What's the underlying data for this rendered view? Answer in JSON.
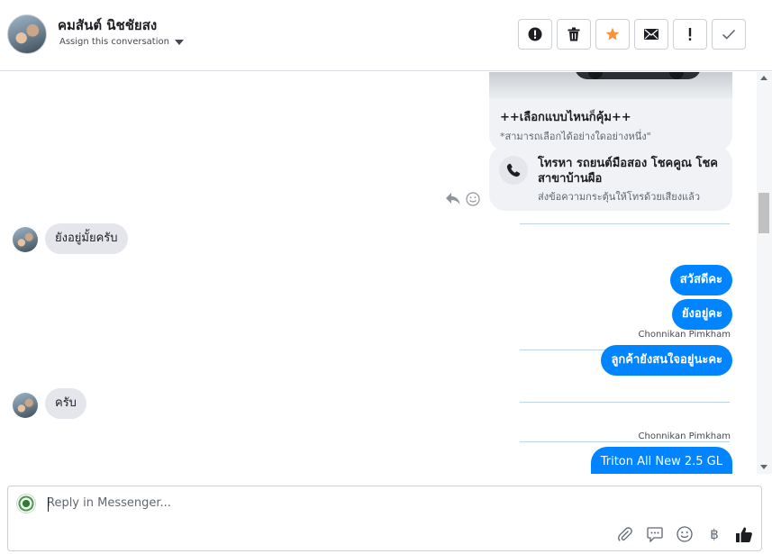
{
  "header": {
    "contact_name": "คมสันต์ นิชชัยสง",
    "assign_label": "Assign this conversation",
    "actions": [
      {
        "name": "spam-button",
        "icon": "exclamation-circle-icon"
      },
      {
        "name": "delete-button",
        "icon": "trash-icon"
      },
      {
        "name": "star-button",
        "icon": "star-icon",
        "color": "#f7923b"
      },
      {
        "name": "mark-unread-button",
        "icon": "envelope-icon"
      },
      {
        "name": "follow-up-button",
        "icon": "exclamation-icon"
      },
      {
        "name": "mark-done-button",
        "icon": "check-icon"
      }
    ]
  },
  "thread": {
    "product_card": {
      "title": "++เลือกแบบไหนก็คุ้ม++",
      "subtitle": "*สามารถเลือกได้อย่างใดอย่างหนึ่ง\""
    },
    "call_card": {
      "title": "โทรหา รถยนต์มือสอง โชคคูณ โชค สาขาบ้านผือ",
      "subtitle": "ส่งข้อความกระตุ้นให้โทรด้วยเสียงแล้ว"
    },
    "messages": [
      {
        "direction": "in",
        "text": "ยังอยู่มั้ยครับ"
      },
      {
        "direction": "out",
        "text": "สวัสดีคะ"
      },
      {
        "direction": "out",
        "text": "ยังอยู่คะ"
      },
      {
        "direction": "out",
        "sender": "Chonnikan Pimkham",
        "text": "ลูกค้ายังสนใจอยู่นะคะ"
      },
      {
        "direction": "in",
        "text": "ครับ"
      },
      {
        "direction": "out",
        "sender": "Chonnikan Pimkham",
        "text": "Triton All New 2.5 GL"
      }
    ]
  },
  "composer": {
    "placeholder": "Reply in Messenger...",
    "tools": [
      "paperclip-icon",
      "saved-reply-icon",
      "emoji-icon",
      "baht-icon",
      "like-icon"
    ],
    "accent": "#0084ff"
  }
}
